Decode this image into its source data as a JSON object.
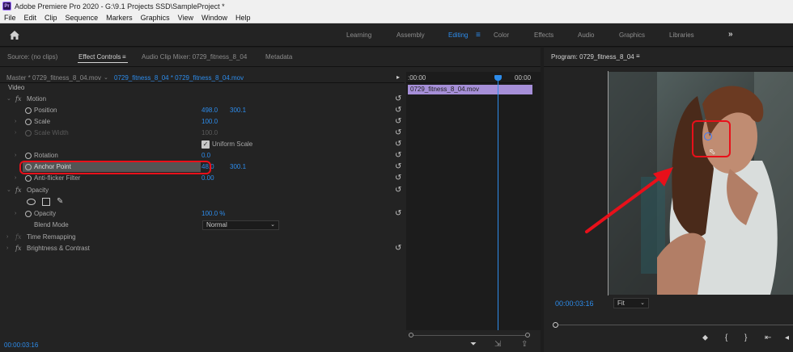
{
  "titlebar": {
    "app_icon": "Pr",
    "title": "Adobe Premiere Pro 2020 - G:\\9.1 Projects SSD\\SampleProject *"
  },
  "menubar": [
    "File",
    "Edit",
    "Clip",
    "Sequence",
    "Markers",
    "Graphics",
    "View",
    "Window",
    "Help"
  ],
  "workspaces": [
    "Learning",
    "Assembly",
    "Editing",
    "Color",
    "Effects",
    "Audio",
    "Graphics",
    "Libraries"
  ],
  "workspace_active": "Editing",
  "workspace_more": "»",
  "effect_panel": {
    "tabs": [
      "Source: (no clips)",
      "Effect Controls",
      "Audio Clip Mixer: 0729_fitness_8_04",
      "Metadata"
    ],
    "tab_menu": "≡",
    "master_label": "Master * 0729_fitness_8_04.mov",
    "clip_label": "0729_fitness_8_04 * 0729_fitness_8_04.mov",
    "section_video": "Video",
    "motion": "Motion",
    "position_label": "Position",
    "position_x": "498.0",
    "position_y": "300.1",
    "scale_label": "Scale",
    "scale_value": "100.0",
    "scale_width_label": "Scale Width",
    "scale_width_value": "100.0",
    "uniform_scale_label": "Uniform Scale",
    "rotation_label": "Rotation",
    "rotation_value": "0.0",
    "anchor_label": "Anchor Point",
    "anchor_x": "48.0",
    "anchor_y": "300.1",
    "antiflicker_label": "Anti-flicker Filter",
    "antiflicker_value": "0.00",
    "opacity": "Opacity",
    "opacity_label": "Opacity",
    "opacity_value": "100.0 %",
    "blend_label": "Blend Mode",
    "blend_value": "Normal",
    "time_remap": "Time Remapping",
    "brightness": "Brightness & Contrast",
    "timecode": "00:00:03:16",
    "fx": "fx",
    "reset": "↺"
  },
  "timeline": {
    "start": ":00:00",
    "end": "00:00",
    "clip": "0729_fitness_8_04.mov"
  },
  "program": {
    "title": "Program: 0729_fitness_8_04",
    "menu": "≡",
    "timecode": "00:00:03:16",
    "fit": "Fit"
  },
  "colors": {
    "accent": "#2d8ceb",
    "highlight": "#e8101a",
    "clip": "#a68fd8"
  }
}
